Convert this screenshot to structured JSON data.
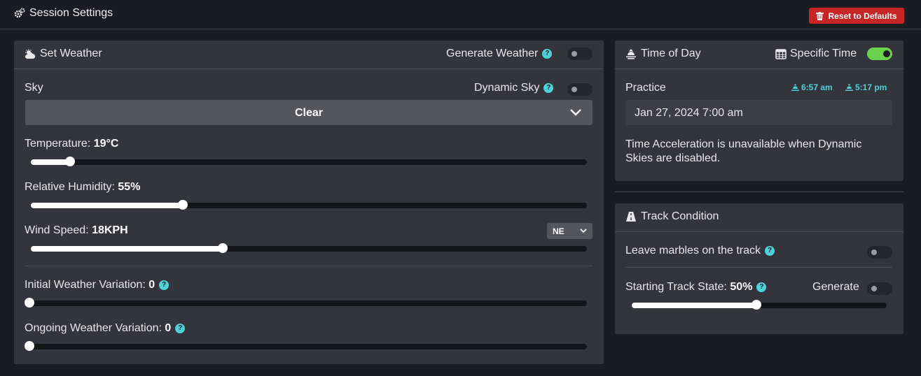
{
  "header": {
    "title": "Session Settings",
    "reset_label": "Reset to Defaults"
  },
  "weather": {
    "title": "Set Weather",
    "generate_label": "Generate Weather",
    "generate_on": false,
    "sky_label": "Sky",
    "dynamic_sky_label": "Dynamic Sky",
    "dynamic_sky_on": false,
    "sky_value": "Clear",
    "temperature": {
      "label": "Temperature:",
      "value": "19°C",
      "fraction": 0.07
    },
    "humidity": {
      "label": "Relative Humidity:",
      "value": "55%",
      "fraction": 0.273
    },
    "wind": {
      "label": "Wind Speed:",
      "value": "18KPH",
      "fraction": 0.345,
      "direction": "NE"
    },
    "initial_variation": {
      "label": "Initial Weather Variation:",
      "value": "0",
      "fraction": 0.0
    },
    "ongoing_variation": {
      "label": "Ongoing Weather Variation:",
      "value": "0",
      "fraction": 0.0
    }
  },
  "time_of_day": {
    "title": "Time of Day",
    "specific_time_label": "Specific Time",
    "specific_time_on": true,
    "session_label": "Practice",
    "sunrise": "6:57 am",
    "sunset": "5:17 pm",
    "datetime_value": "Jan 27, 2024 7:00 am",
    "note": "Time Acceleration is unavailable when Dynamic Skies are disabled."
  },
  "track_condition": {
    "title": "Track Condition",
    "marbles_label": "Leave marbles on the track",
    "marbles_on": false,
    "starting_state": {
      "label": "Starting Track State:",
      "value": "50%",
      "fraction": 0.49
    },
    "generate_label": "Generate",
    "generate_on": false
  },
  "colors": {
    "accent": "#4fd1d9",
    "toggle_on": "#6bd24d",
    "danger": "#c72525"
  }
}
